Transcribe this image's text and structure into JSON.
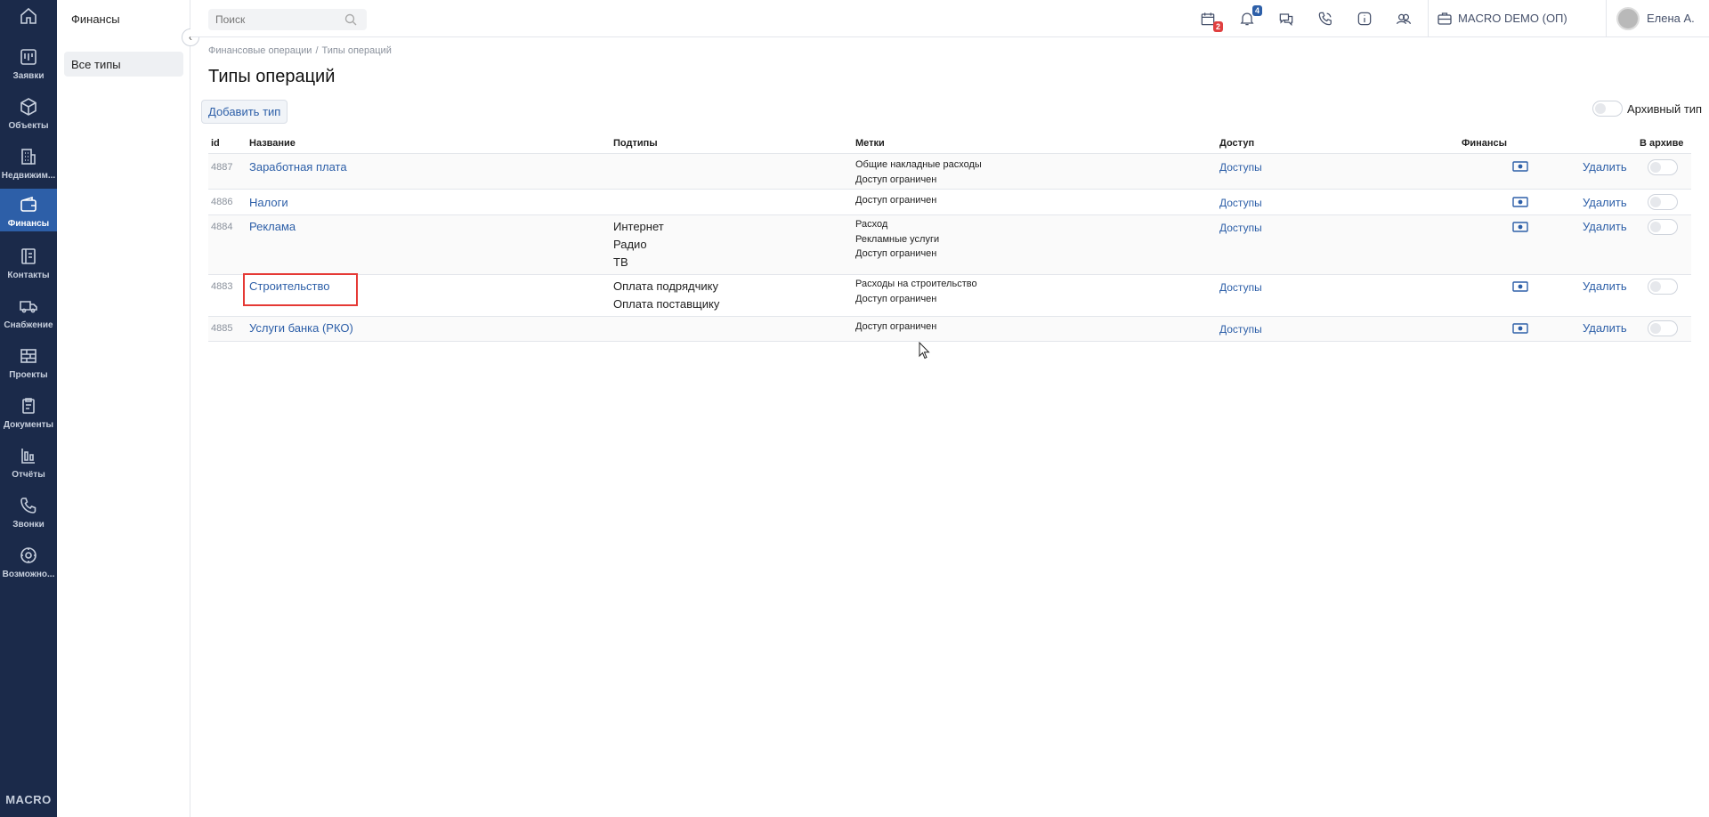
{
  "rail": {
    "items": [
      {
        "label": "",
        "icon": "home-icon"
      },
      {
        "label": "Заявки",
        "icon": "kanban-icon"
      },
      {
        "label": "Объекты",
        "icon": "cube-icon"
      },
      {
        "label": "Недвижим...",
        "icon": "building-icon"
      },
      {
        "label": "Финансы",
        "icon": "wallet-icon",
        "active": true
      },
      {
        "label": "Контакты",
        "icon": "contacts-icon"
      },
      {
        "label": "Снабжение",
        "icon": "truck-icon"
      },
      {
        "label": "Проекты",
        "icon": "bricks-icon"
      },
      {
        "label": "Документы",
        "icon": "clipboard-icon"
      },
      {
        "label": "Отчёты",
        "icon": "bar-chart-icon"
      },
      {
        "label": "Звонки",
        "icon": "phone-icon"
      },
      {
        "label": "Возможно...",
        "icon": "gear-icon"
      }
    ],
    "brand": "MACRO"
  },
  "subnav": {
    "title": "Финансы",
    "items": [
      {
        "label": "Все типы"
      }
    ]
  },
  "topbar": {
    "search_placeholder": "Поиск",
    "calendar_badge": "2",
    "notifications_badge": "4",
    "company": "MACRO DEMO (ОП)",
    "user": "Елена А."
  },
  "breadcrumb": [
    "Финансовые операции",
    "Типы операций"
  ],
  "page_title": "Типы операций",
  "add_button": "Добавить тип",
  "archive_toggle_label": "Архивный тип",
  "table": {
    "headers": {
      "id": "id",
      "name": "Название",
      "subtypes": "Подтипы",
      "tags": "Метки",
      "access": "Доступ",
      "finance": "Финансы",
      "archived": "В архиве"
    },
    "rows": [
      {
        "id": "4887",
        "name": "Заработная плата",
        "subtypes": [],
        "tags": [
          "Общие накладные расходы",
          "Доступ ограничен"
        ],
        "access": "Доступы",
        "delete": "Удалить"
      },
      {
        "id": "4886",
        "name": "Налоги",
        "subtypes": [],
        "tags": [
          "Доступ ограничен"
        ],
        "access": "Доступы",
        "delete": "Удалить"
      },
      {
        "id": "4884",
        "name": "Реклама",
        "subtypes": [
          "Интернет",
          "Радио",
          "ТВ"
        ],
        "tags": [
          "Расход",
          "Рекламные услуги",
          "Доступ ограничен"
        ],
        "access": "Доступы",
        "delete": "Удалить"
      },
      {
        "id": "4883",
        "name": "Строительство",
        "subtypes": [
          "Оплата подрядчику",
          "Оплата поставщику"
        ],
        "tags": [
          "Расходы на строительство",
          "Доступ ограничен"
        ],
        "access": "Доступы",
        "delete": "Удалить"
      },
      {
        "id": "4885",
        "name": "Услуги банка (РКО)",
        "subtypes": [],
        "tags": [
          "Доступ ограничен"
        ],
        "access": "Доступы",
        "delete": "Удалить"
      }
    ]
  },
  "colors": {
    "rail_bg": "#1b2a4a",
    "accent": "#2d5fa8",
    "highlight": "#e53935"
  }
}
